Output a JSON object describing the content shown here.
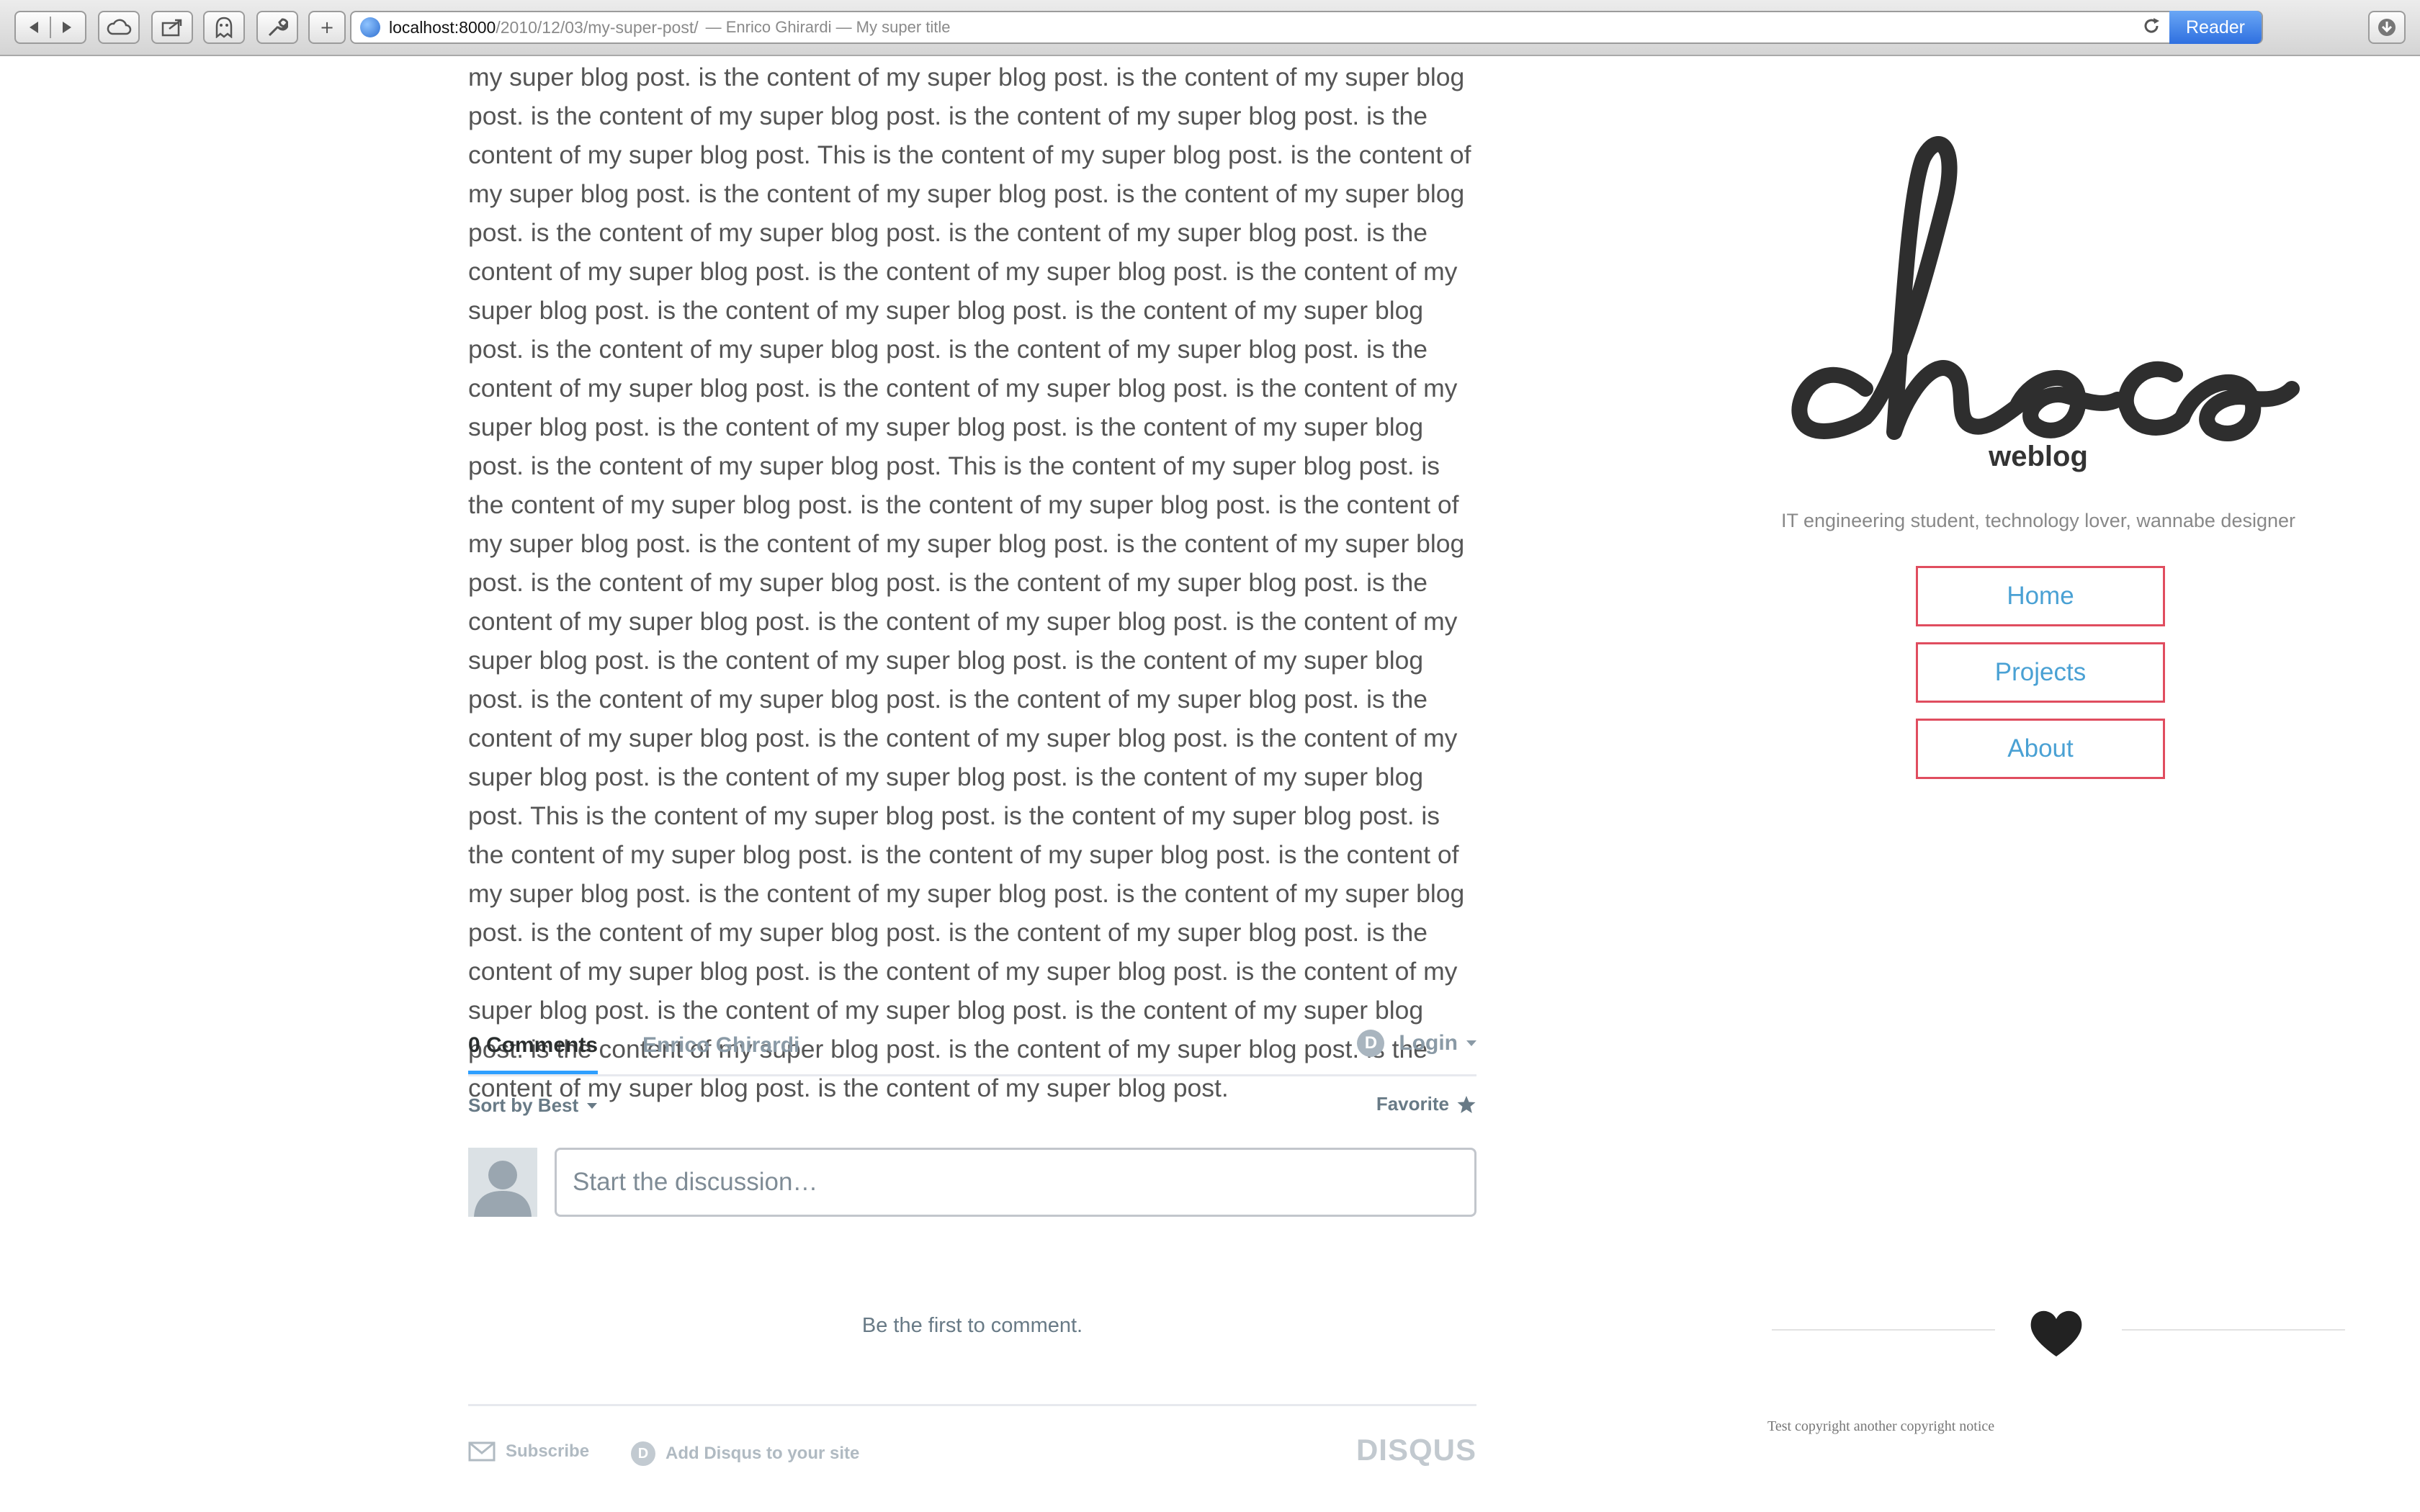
{
  "browser": {
    "url_host": "localhost:8000",
    "url_path": "/2010/12/03/my-super-post/",
    "page_title": "— Enrico Ghirardi — My super title",
    "reader_label": "Reader",
    "add_tab_label": "+"
  },
  "article": {
    "body": "my super blog post. is the content of my super blog post. is the content of my super blog post. is the content of my super blog post. is the content of my super blog post. is the content of my super blog post. This is the content of my super blog post. is the content of my super blog post. is the content of my super blog post. is the content of my super blog post. is the content of my super blog post. is the content of my super blog post. is the content of my super blog post. is the content of my super blog post. is the content of my super blog post. is the content of my super blog post. is the content of my super blog post. is the content of my super blog post. is the content of my super blog post. is the content of my super blog post. is the content of my super blog post. is the content of my super blog post. is the content of my super blog post. is the content of my super blog post. is the content of my super blog post. This is the content of my super blog post. is the content of my super blog post. is the content of my super blog post. is the content of my super blog post. is the content of my super blog post. is the content of my super blog post. is the content of my super blog post. is the content of my super blog post. is the content of my super blog post. is the content of my super blog post. is the content of my super blog post. is the content of my super blog post. is the content of my super blog post. is the content of my super blog post. is the content of my super blog post. is the content of my super blog post. is the content of my super blog post. is the content of my super blog post. is the content of my super blog post. is the content of my super blog post. This is the content of my super blog post. is the content of my super blog post. is the content of my super blog post. is the content of my super blog post. is the content of my super blog post. is the content of my super blog post. is the content of my super blog post. is the content of my super blog post. is the content of my super blog post. is the content of my super blog post. is the content of my super blog post. is the content of my super blog post. is the content of my super blog post. is the content of my super blog post. is the content of my super blog post. is the content of my super blog post. is the content of my super blog post. is the content of my super blog post."
  },
  "comments": {
    "tab_count": "0 Comments",
    "tab_user": "Enrico Ghirardi",
    "login": "Login",
    "sort": "Sort by Best",
    "favorite": "Favorite",
    "input_placeholder": "Start the discussion…",
    "empty_message": "Be the first to comment.",
    "subscribe": "Subscribe",
    "add_disqus": "Add Disqus to your site",
    "brand": "DISQUS",
    "d_glyph": "D"
  },
  "sidebar": {
    "logo_text": "choco",
    "subtitle": "weblog",
    "tagline": "IT engineering student, technology lover, wannabe designer",
    "nav": [
      {
        "label": "Home"
      },
      {
        "label": "Projects"
      },
      {
        "label": "About"
      }
    ]
  },
  "footer": {
    "copyright": "Test copyright another copyright notice"
  },
  "colors": {
    "accent_link": "#4aa1d4",
    "nav_border": "#e04d5f",
    "disqus_blue": "#2e9fff",
    "body_text": "#555555"
  },
  "icons": [
    "back-icon",
    "forward-icon",
    "cloud-icon",
    "share-icon",
    "shield-icon",
    "wrench-icon",
    "add-icon",
    "globe-icon",
    "reload-icon",
    "download-icon",
    "disqus-d-icon",
    "caret-icon",
    "star-icon",
    "user-icon",
    "envelope-icon",
    "heart-icon"
  ]
}
